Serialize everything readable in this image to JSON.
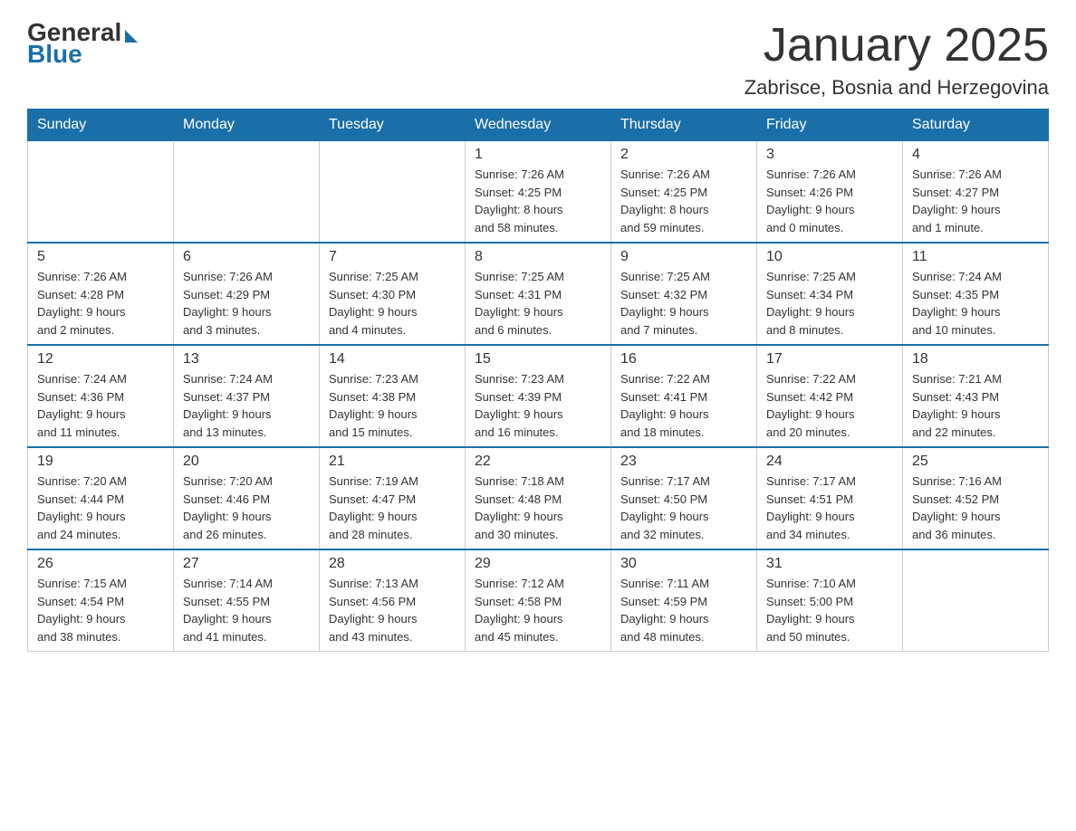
{
  "logo": {
    "general": "General",
    "blue": "Blue"
  },
  "title": "January 2025",
  "location": "Zabrisce, Bosnia and Herzegovina",
  "days_of_week": [
    "Sunday",
    "Monday",
    "Tuesday",
    "Wednesday",
    "Thursday",
    "Friday",
    "Saturday"
  ],
  "weeks": [
    [
      {
        "day": "",
        "info": ""
      },
      {
        "day": "",
        "info": ""
      },
      {
        "day": "",
        "info": ""
      },
      {
        "day": "1",
        "info": "Sunrise: 7:26 AM\nSunset: 4:25 PM\nDaylight: 8 hours\nand 58 minutes."
      },
      {
        "day": "2",
        "info": "Sunrise: 7:26 AM\nSunset: 4:25 PM\nDaylight: 8 hours\nand 59 minutes."
      },
      {
        "day": "3",
        "info": "Sunrise: 7:26 AM\nSunset: 4:26 PM\nDaylight: 9 hours\nand 0 minutes."
      },
      {
        "day": "4",
        "info": "Sunrise: 7:26 AM\nSunset: 4:27 PM\nDaylight: 9 hours\nand 1 minute."
      }
    ],
    [
      {
        "day": "5",
        "info": "Sunrise: 7:26 AM\nSunset: 4:28 PM\nDaylight: 9 hours\nand 2 minutes."
      },
      {
        "day": "6",
        "info": "Sunrise: 7:26 AM\nSunset: 4:29 PM\nDaylight: 9 hours\nand 3 minutes."
      },
      {
        "day": "7",
        "info": "Sunrise: 7:25 AM\nSunset: 4:30 PM\nDaylight: 9 hours\nand 4 minutes."
      },
      {
        "day": "8",
        "info": "Sunrise: 7:25 AM\nSunset: 4:31 PM\nDaylight: 9 hours\nand 6 minutes."
      },
      {
        "day": "9",
        "info": "Sunrise: 7:25 AM\nSunset: 4:32 PM\nDaylight: 9 hours\nand 7 minutes."
      },
      {
        "day": "10",
        "info": "Sunrise: 7:25 AM\nSunset: 4:34 PM\nDaylight: 9 hours\nand 8 minutes."
      },
      {
        "day": "11",
        "info": "Sunrise: 7:24 AM\nSunset: 4:35 PM\nDaylight: 9 hours\nand 10 minutes."
      }
    ],
    [
      {
        "day": "12",
        "info": "Sunrise: 7:24 AM\nSunset: 4:36 PM\nDaylight: 9 hours\nand 11 minutes."
      },
      {
        "day": "13",
        "info": "Sunrise: 7:24 AM\nSunset: 4:37 PM\nDaylight: 9 hours\nand 13 minutes."
      },
      {
        "day": "14",
        "info": "Sunrise: 7:23 AM\nSunset: 4:38 PM\nDaylight: 9 hours\nand 15 minutes."
      },
      {
        "day": "15",
        "info": "Sunrise: 7:23 AM\nSunset: 4:39 PM\nDaylight: 9 hours\nand 16 minutes."
      },
      {
        "day": "16",
        "info": "Sunrise: 7:22 AM\nSunset: 4:41 PM\nDaylight: 9 hours\nand 18 minutes."
      },
      {
        "day": "17",
        "info": "Sunrise: 7:22 AM\nSunset: 4:42 PM\nDaylight: 9 hours\nand 20 minutes."
      },
      {
        "day": "18",
        "info": "Sunrise: 7:21 AM\nSunset: 4:43 PM\nDaylight: 9 hours\nand 22 minutes."
      }
    ],
    [
      {
        "day": "19",
        "info": "Sunrise: 7:20 AM\nSunset: 4:44 PM\nDaylight: 9 hours\nand 24 minutes."
      },
      {
        "day": "20",
        "info": "Sunrise: 7:20 AM\nSunset: 4:46 PM\nDaylight: 9 hours\nand 26 minutes."
      },
      {
        "day": "21",
        "info": "Sunrise: 7:19 AM\nSunset: 4:47 PM\nDaylight: 9 hours\nand 28 minutes."
      },
      {
        "day": "22",
        "info": "Sunrise: 7:18 AM\nSunset: 4:48 PM\nDaylight: 9 hours\nand 30 minutes."
      },
      {
        "day": "23",
        "info": "Sunrise: 7:17 AM\nSunset: 4:50 PM\nDaylight: 9 hours\nand 32 minutes."
      },
      {
        "day": "24",
        "info": "Sunrise: 7:17 AM\nSunset: 4:51 PM\nDaylight: 9 hours\nand 34 minutes."
      },
      {
        "day": "25",
        "info": "Sunrise: 7:16 AM\nSunset: 4:52 PM\nDaylight: 9 hours\nand 36 minutes."
      }
    ],
    [
      {
        "day": "26",
        "info": "Sunrise: 7:15 AM\nSunset: 4:54 PM\nDaylight: 9 hours\nand 38 minutes."
      },
      {
        "day": "27",
        "info": "Sunrise: 7:14 AM\nSunset: 4:55 PM\nDaylight: 9 hours\nand 41 minutes."
      },
      {
        "day": "28",
        "info": "Sunrise: 7:13 AM\nSunset: 4:56 PM\nDaylight: 9 hours\nand 43 minutes."
      },
      {
        "day": "29",
        "info": "Sunrise: 7:12 AM\nSunset: 4:58 PM\nDaylight: 9 hours\nand 45 minutes."
      },
      {
        "day": "30",
        "info": "Sunrise: 7:11 AM\nSunset: 4:59 PM\nDaylight: 9 hours\nand 48 minutes."
      },
      {
        "day": "31",
        "info": "Sunrise: 7:10 AM\nSunset: 5:00 PM\nDaylight: 9 hours\nand 50 minutes."
      },
      {
        "day": "",
        "info": ""
      }
    ]
  ]
}
